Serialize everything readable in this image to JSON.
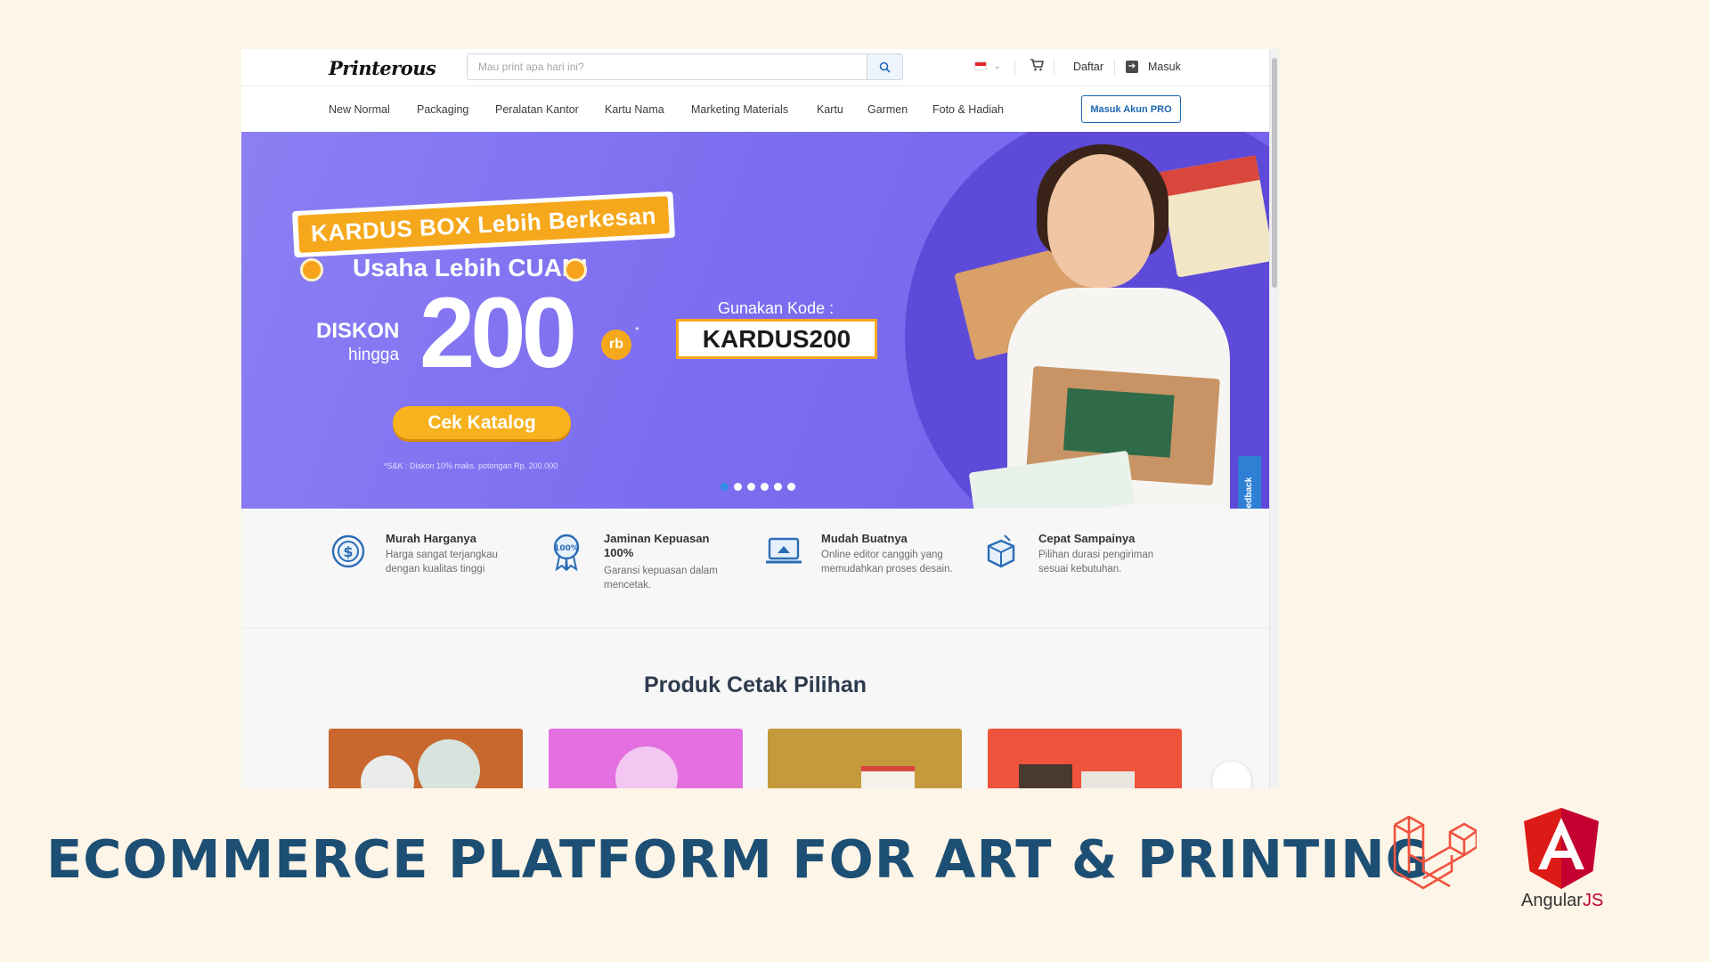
{
  "header": {
    "logo": "Printerous",
    "search_placeholder": "Mau print apa hari ini?",
    "register": "Daftar",
    "login": "Masuk"
  },
  "categories": [
    "New Normal",
    "Packaging",
    "Peralatan Kantor",
    "Kartu Nama",
    "Marketing Materials",
    "Kartu",
    "Garmen",
    "Foto & Hadiah"
  ],
  "pro_button": "Masuk Akun PRO",
  "hero": {
    "ribbon": "KARDUS BOX Lebih Berkesan",
    "subtitle": "Usaha Lebih CUAN!",
    "discount_label": "DISKON",
    "discount_up_to": "hingga",
    "discount_value": "200",
    "discount_unit": "rb",
    "discount_asterisk": "*",
    "cta": "Cek Katalog",
    "terms": "*S&K : Diskon 10% maks. potongan Rp. 200.000",
    "code_label": "Gunakan Kode :",
    "code": "KARDUS200",
    "slides": 6,
    "active_slide": 1
  },
  "feedback": "Feedback",
  "features": [
    {
      "title": "Murah Harganya",
      "desc": "Harga sangat terjangkau dengan kualitas tinggi",
      "icon": "dollar-cycle-icon"
    },
    {
      "title": "Jaminan Kepuasan 100%",
      "desc": "Garansi kepuasan dalam mencetak.",
      "icon": "badge-100-icon"
    },
    {
      "title": "Mudah Buatnya",
      "desc": "Online editor canggih yang memudahkan proses desain.",
      "icon": "laptop-editor-icon"
    },
    {
      "title": "Cepat Sampainya",
      "desc": "Pilihan durasi pengiriman sesuai kebutuhan.",
      "icon": "box-delivery-icon"
    }
  ],
  "products_title": "Produk Cetak Pilihan",
  "product_colors": [
    "#c8682e",
    "#e36fe0",
    "#c49a3c",
    "#f0533b"
  ],
  "caption": "ECOMMERCE PLATFORM FOR ART & PRINTING",
  "tech_logos": {
    "laravel_color": "#f05340",
    "angular_color": "#dd1b16",
    "angular_label_main": "Angular",
    "angular_label_suffix": "JS"
  }
}
